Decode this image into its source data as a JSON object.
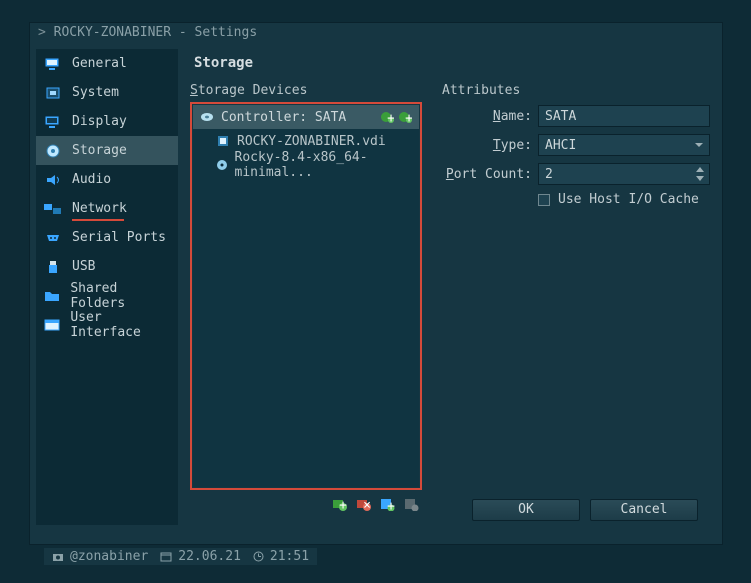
{
  "window": {
    "title": "ROCKY-ZONABINER - Settings"
  },
  "sidebar": {
    "items": [
      {
        "label": "General"
      },
      {
        "label": "System"
      },
      {
        "label": "Display"
      },
      {
        "label": "Storage"
      },
      {
        "label": "Audio"
      },
      {
        "label": "Network"
      },
      {
        "label": "Serial Ports"
      },
      {
        "label": "USB"
      },
      {
        "label": "Shared Folders"
      },
      {
        "label": "User Interface"
      }
    ]
  },
  "page": {
    "heading": "Storage",
    "devices_label": "Storage Devices",
    "attributes_label": "Attributes",
    "tree": {
      "controller_label": "Controller: SATA",
      "children": [
        "ROCKY-ZONABINER.vdi",
        "Rocky-8.4-x86_64-minimal..."
      ]
    },
    "attributes": {
      "name_label": "Name:",
      "name_value": "SATA",
      "type_label": "Type:",
      "type_value": "AHCI",
      "port_label": "Port Count:",
      "port_value": "2",
      "hostio_label": "Use Host I/O Cache"
    }
  },
  "buttons": {
    "ok": "OK",
    "cancel": "Cancel"
  },
  "status": {
    "user": "@zonabiner",
    "date": "22.06.21",
    "time": "21:51"
  }
}
